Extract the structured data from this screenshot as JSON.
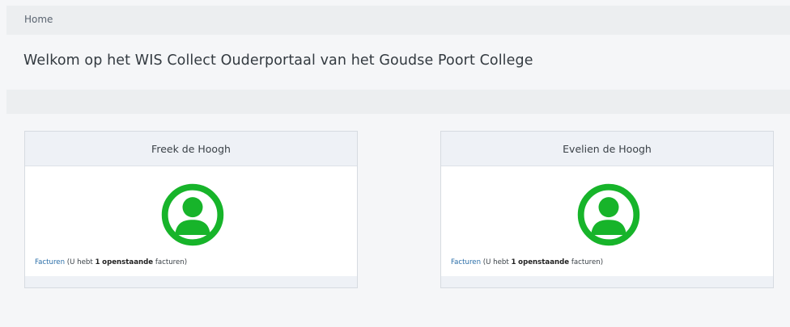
{
  "breadcrumb": {
    "home_label": "Home"
  },
  "header": {
    "title": "Welkom op het WIS Collect Ouderportaal van het Goudse Poort College"
  },
  "students": [
    {
      "name": "Freek de Hoogh",
      "avatar_icon": "user-circle-icon",
      "invoices_link_label": "Facturen",
      "status_prefix": "(U hebt",
      "open_count": "1",
      "open_word": "openstaande",
      "status_suffix": "facturen)"
    },
    {
      "name": "Evelien de Hoogh",
      "avatar_icon": "user-circle-icon",
      "invoices_link_label": "Facturen",
      "status_prefix": "(U hebt",
      "open_count": "1",
      "open_word": "openstaande",
      "status_suffix": "facturen)"
    }
  ],
  "colors": {
    "avatar_green": "#17b42a",
    "link_blue": "#2a6ea8",
    "card_header_bg": "#eef1f6",
    "page_bg": "#f5f6f8"
  }
}
